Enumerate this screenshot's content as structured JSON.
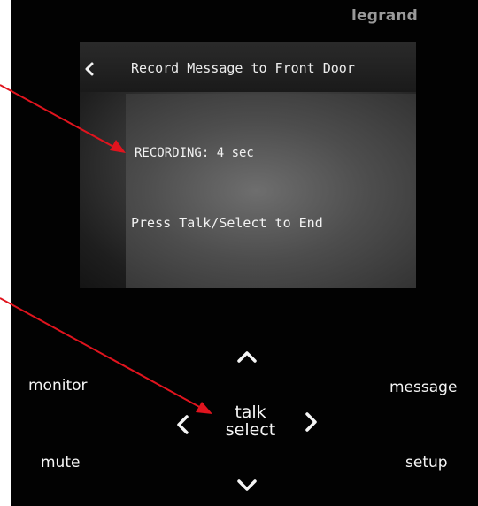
{
  "brand": "legrand",
  "screen": {
    "title": "Record Message to Front Door",
    "status": "RECORDING: 4 sec",
    "hint": "Press Talk/Select to End"
  },
  "buttons": {
    "monitor": "monitor",
    "message": "message",
    "mute": "mute",
    "setup": "setup",
    "talk": "talk",
    "select": "select"
  },
  "icons": {
    "back": "chevron-left-icon",
    "up": "chevron-up-icon",
    "down": "chevron-down-icon",
    "left": "chevron-left-icon",
    "right": "chevron-right-icon"
  },
  "colors": {
    "device_body": "#020202",
    "brand_text": "#9a9a9a",
    "label_text": "#f5f5f5",
    "annotation_arrow": "#e0141e"
  }
}
